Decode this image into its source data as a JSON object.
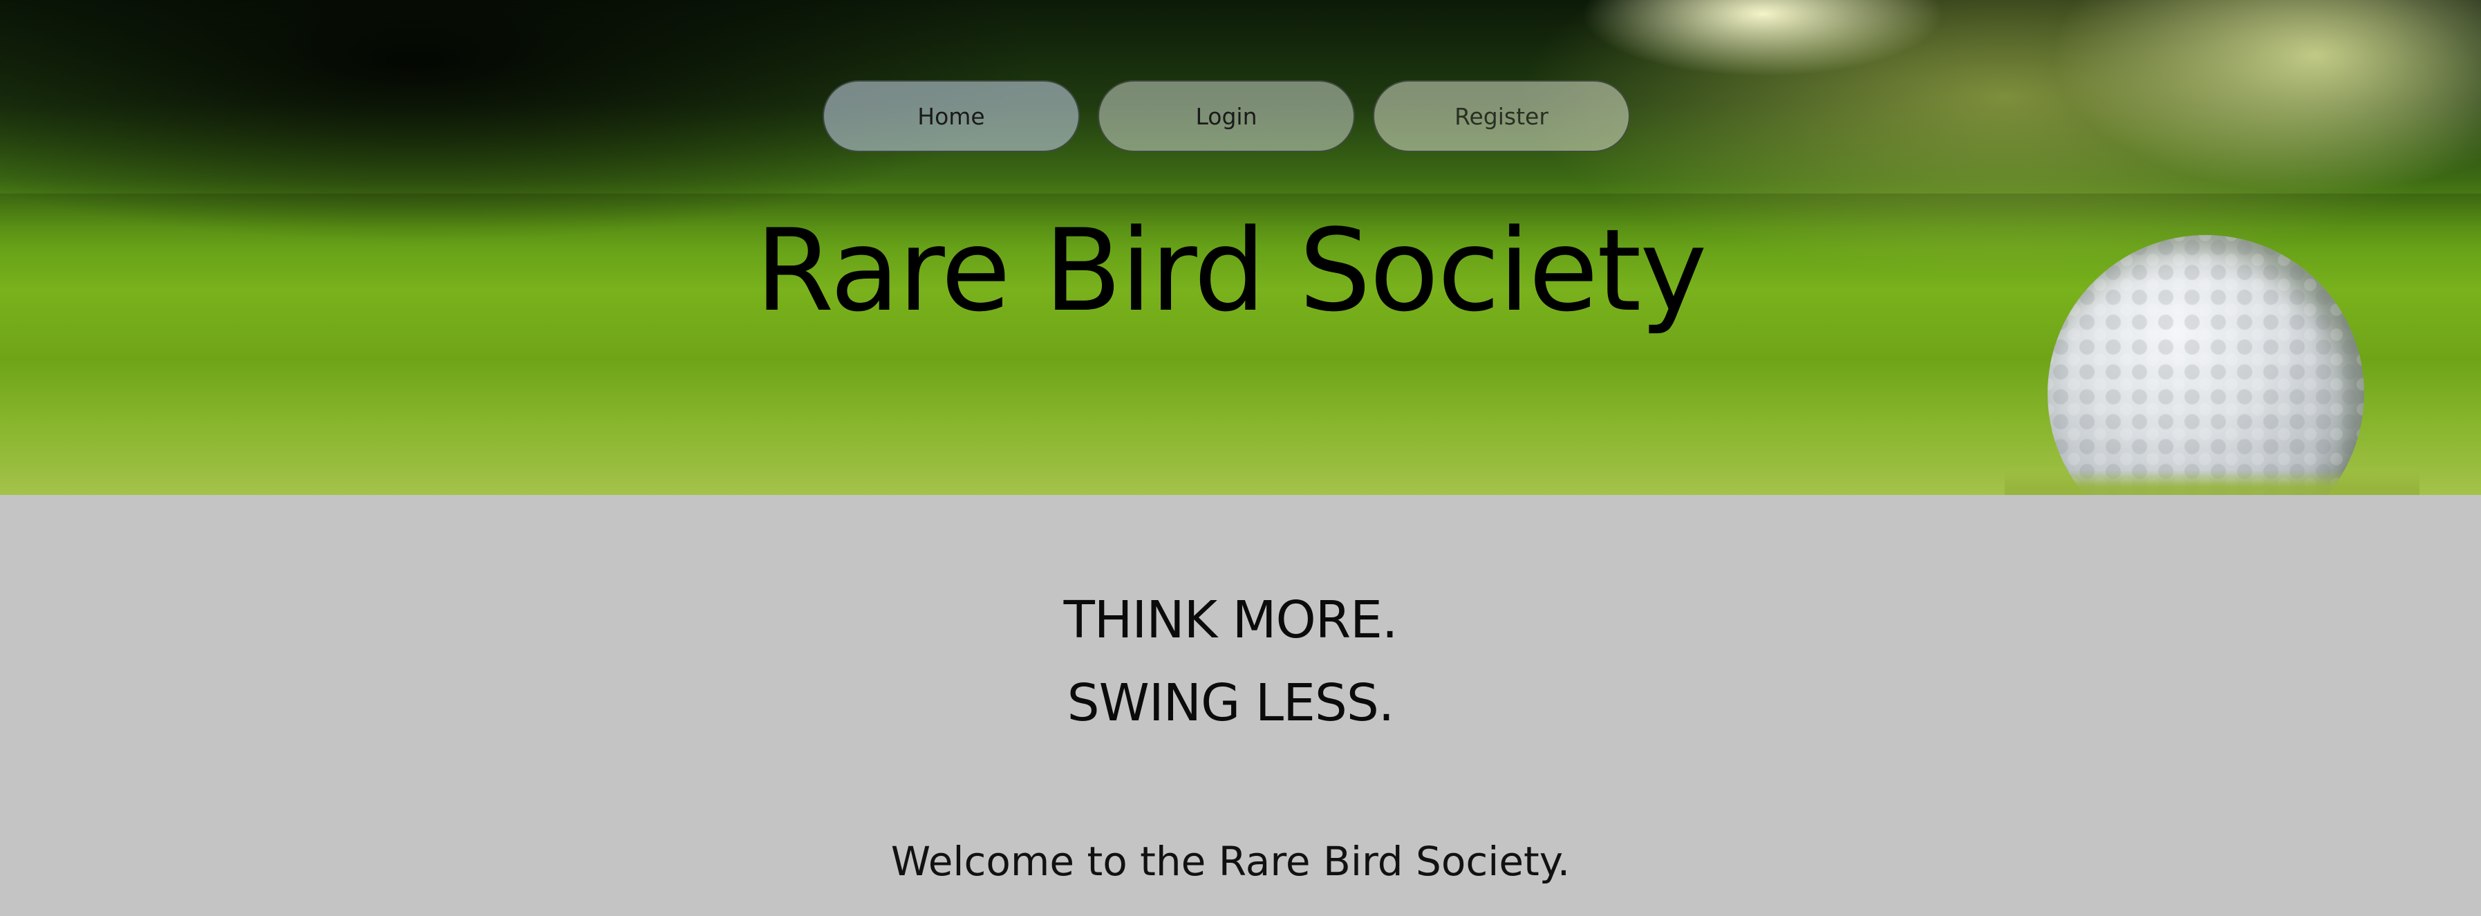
{
  "nav": {
    "home_label": "Home",
    "login_label": "Login",
    "register_label": "Register"
  },
  "hero": {
    "title": "Rare Bird Society"
  },
  "main": {
    "tagline_line1": "THINK MORE.",
    "tagline_line2": "SWING LESS.",
    "welcome": "Welcome to the Rare Bird Society."
  },
  "colors": {
    "page_background": "#c4c4c4",
    "title_text": "#000000"
  }
}
